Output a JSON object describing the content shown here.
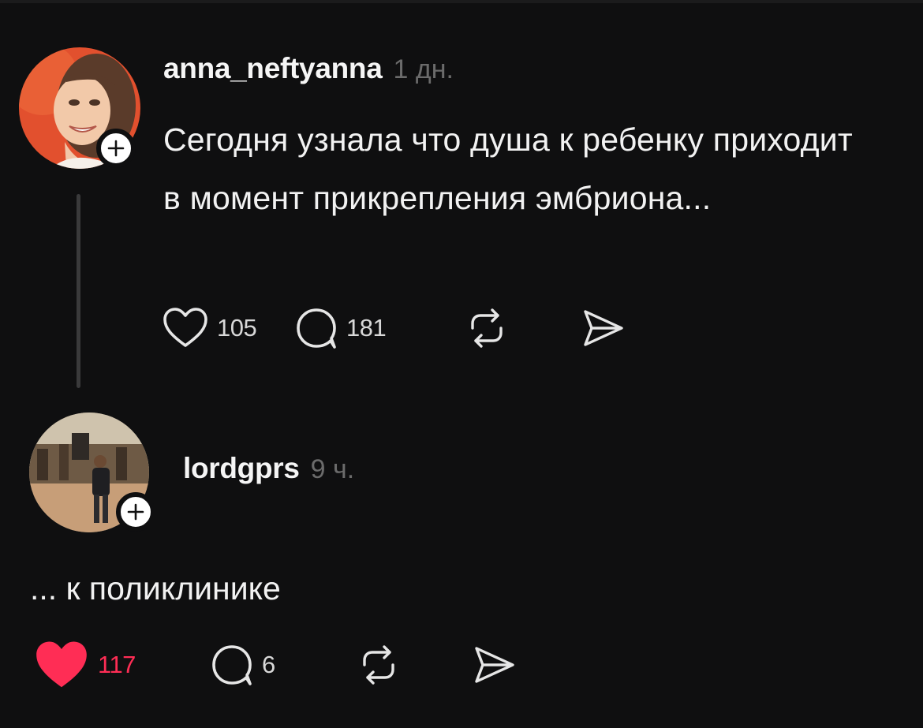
{
  "posts": [
    {
      "username": "anna_neftyanna",
      "time": "1 дн.",
      "text": "Сегодня узнала что душа к ребенку приходит в момент прикрепления эмбриона...",
      "likes": "105",
      "comments": "181",
      "liked": false
    },
    {
      "username": "lordgprs",
      "time": "9 ч.",
      "text": "... к поликлинике",
      "likes": "117",
      "comments": "6",
      "liked": true
    }
  ],
  "icons": {
    "like": "heart-outline-icon",
    "liked": "heart-filled-icon",
    "comment": "speech-bubble-icon",
    "repost": "repost-arrows-icon",
    "share": "paper-plane-icon",
    "follow": "plus-icon"
  },
  "colors": {
    "background": "#0f0f10",
    "text": "#f2f2f2",
    "muted": "#6b6b6b",
    "like_active": "#ff2d55",
    "thread_line": "#3a3a3b"
  }
}
